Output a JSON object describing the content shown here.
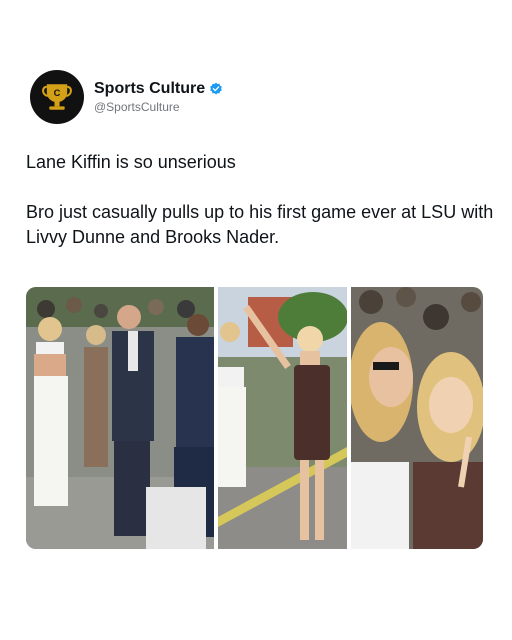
{
  "account": {
    "display_name": "Sports Culture",
    "handle": "@SportsCulture",
    "avatar_icon": "trophy-logo-icon",
    "verified_icon": "verified-badge-icon",
    "verified_color": "#1d9bf0",
    "logo_color": "#d4a017"
  },
  "tweet": {
    "line1": "Lane Kiffin is so unserious",
    "line2": "Bro just casually pulls up to his first game ever at LSU with Livvy Dunne and Brooks Nader."
  },
  "media": {
    "photos": [
      {
        "name": "crowd-walk-photo",
        "icon": "photo"
      },
      {
        "name": "dancing-photo",
        "icon": "photo"
      },
      {
        "name": "selfie-photo",
        "icon": "photo"
      }
    ]
  }
}
